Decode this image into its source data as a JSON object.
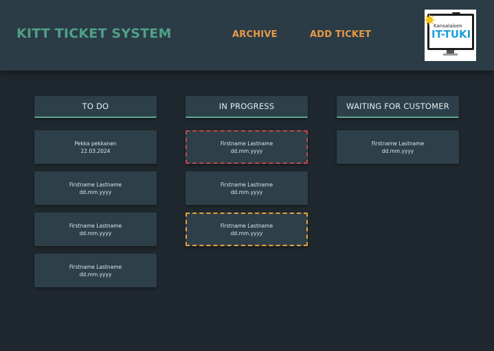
{
  "header": {
    "title": "KITT TICKET SYSTEM",
    "nav": {
      "archive": "ARCHIVE",
      "add_ticket": "ADD TICKET"
    },
    "logo": {
      "top_text": "Kansalaisen",
      "main_text": "IT-TUKI"
    }
  },
  "columns": [
    {
      "title": "TO DO",
      "cards": [
        {
          "name": "Pekka pekkanen",
          "date": "22.03.2024"
        },
        {
          "name": "Firstname Lastname",
          "date": "dd.mm.yyyy"
        },
        {
          "name": "Firstname Lastname",
          "date": "dd.mm.yyyy"
        },
        {
          "name": "Firstname Lastname",
          "date": "dd.mm.yyyy"
        }
      ]
    },
    {
      "title": "IN PROGRESS",
      "cards": [
        {
          "name": "Firstname Lastname",
          "date": "dd.mm.yyyy",
          "status": "red"
        },
        {
          "name": "Firstname Lastname",
          "date": "dd.mm.yyyy"
        },
        {
          "name": "Firstname Lastname",
          "date": "dd.mm.yyyy",
          "status": "orange"
        }
      ]
    },
    {
      "title": "WAITING FOR CUSTOMER",
      "cards": [
        {
          "name": "Firstname Lastname",
          "date": "dd.mm.yyyy"
        }
      ]
    }
  ],
  "colors": {
    "title": "#4fa088",
    "nav": "#e89a45",
    "urgent_border": "#c4484b",
    "warning_border": "#f0a13a"
  }
}
